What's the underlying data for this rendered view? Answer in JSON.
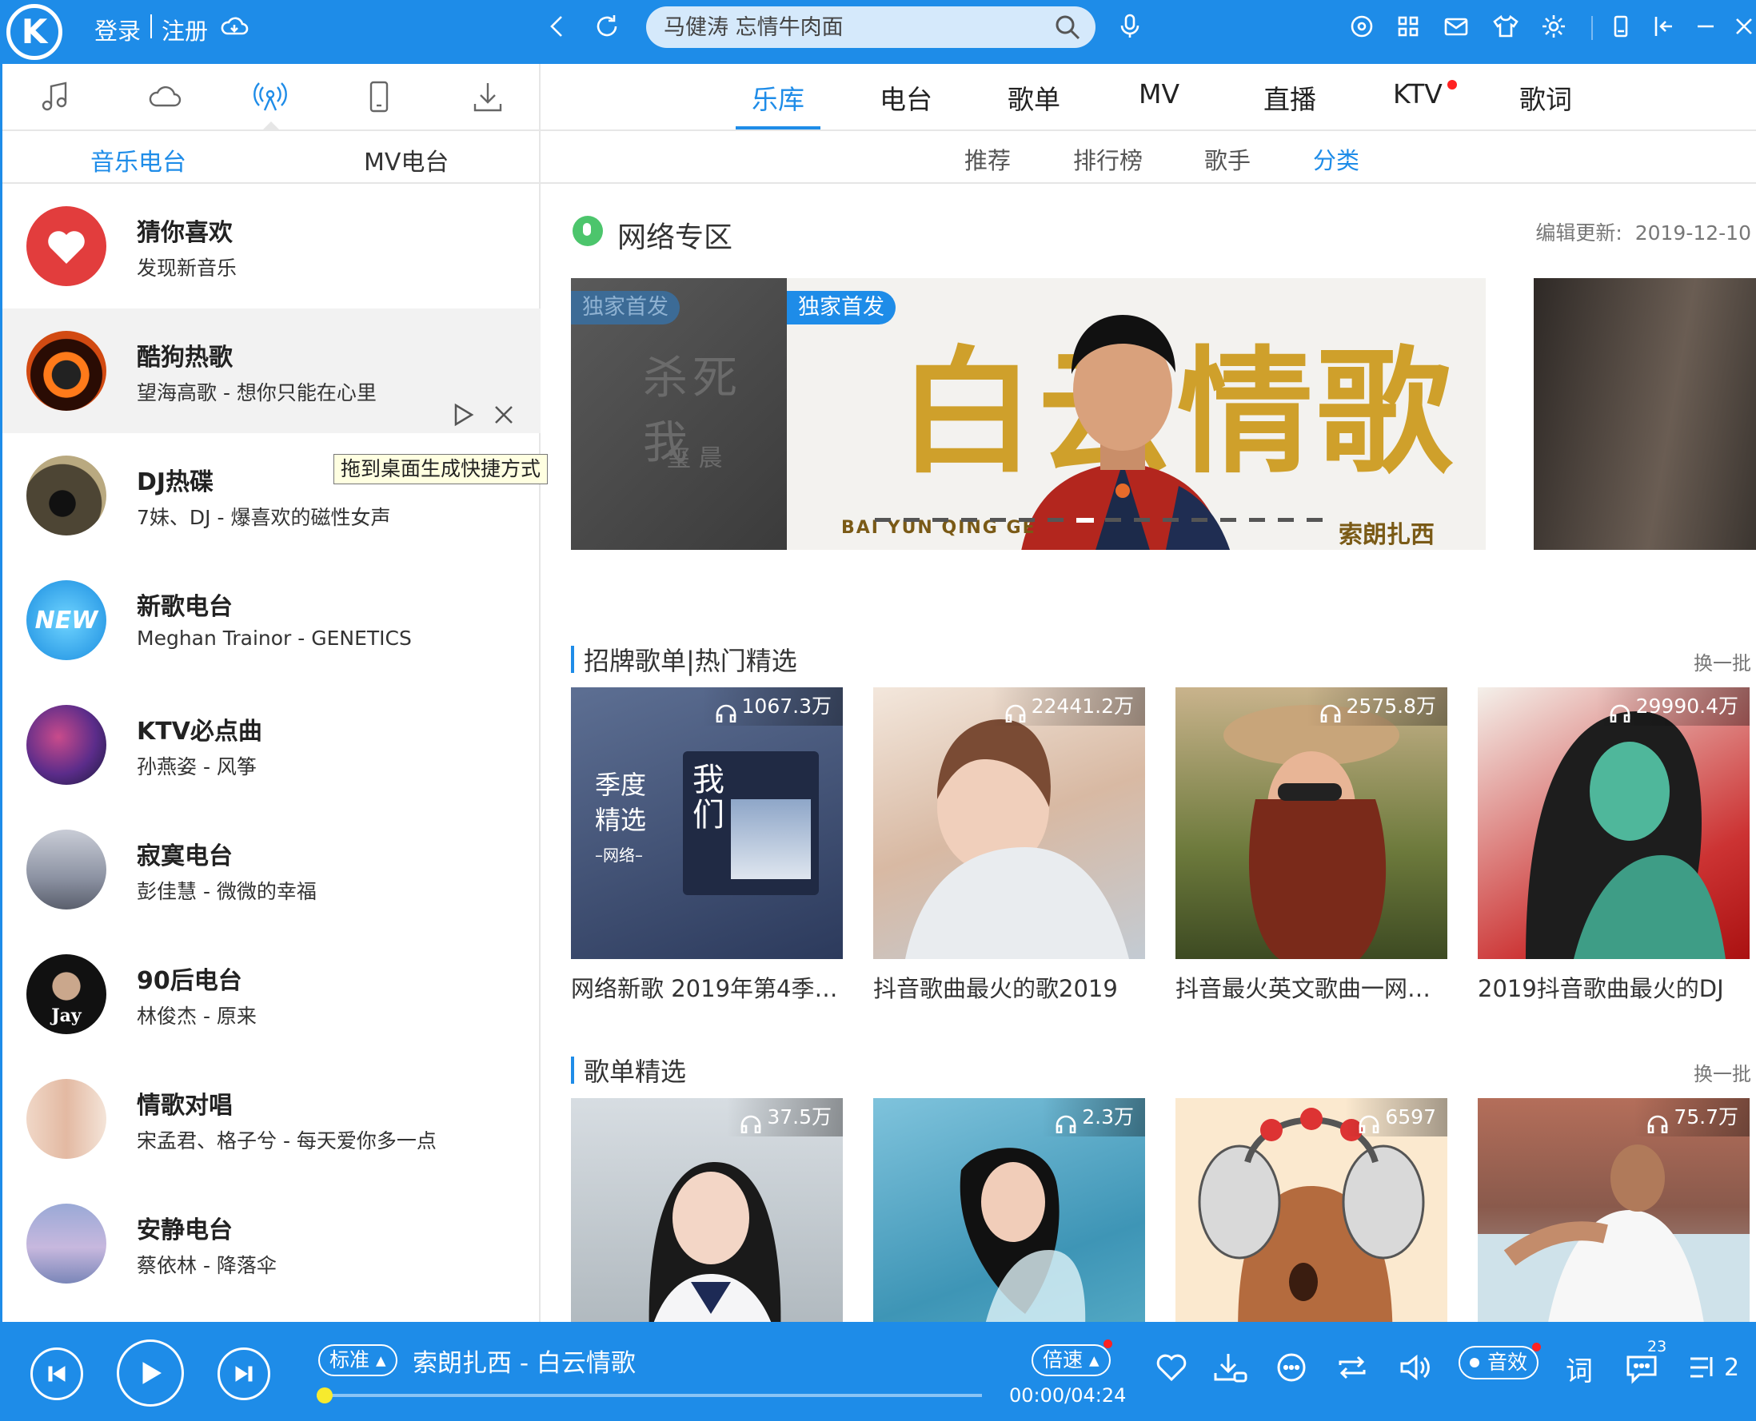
{
  "header": {
    "logo": "K",
    "login": "登录",
    "register": "注册",
    "search_value": "",
    "search_placeholder": "马健涛 忘情牛肉面"
  },
  "left": {
    "subtabs": [
      "音乐电台",
      "MV电台"
    ],
    "items": [
      {
        "title": "猜你喜欢",
        "sub": "发现新音乐"
      },
      {
        "title": "酷狗热歌",
        "sub": "望海高歌 - 想你只能在心里"
      },
      {
        "title": "DJ热碟",
        "sub": "7妹、DJ - 爆喜欢的磁性女声"
      },
      {
        "title": "新歌电台",
        "sub": "Meghan Trainor - GENETICS"
      },
      {
        "title": "KTV必点曲",
        "sub": "孙燕姿 - 风筝"
      },
      {
        "title": "寂寞电台",
        "sub": "彭佳慧 - 微微的幸福"
      },
      {
        "title": "90后电台",
        "sub": "林俊杰 - 原来"
      },
      {
        "title": "情歌对唱",
        "sub": "宋孟君、格子兮 - 每天爱你多一点"
      },
      {
        "title": "安静电台",
        "sub": "蔡依林 - 降落伞"
      }
    ],
    "tooltip": "拖到桌面生成快捷方式",
    "new_badge": "NEW",
    "jay_badge": "Jay"
  },
  "main": {
    "tabs": [
      "乐库",
      "电台",
      "歌单",
      "MV",
      "直播",
      "KTV",
      "歌词"
    ],
    "subnav": [
      "推荐",
      "排行榜",
      "歌手",
      "分类"
    ],
    "section_title": "网络专区",
    "update_label": "编辑更新:",
    "update_date": "2019-12-10",
    "banner": {
      "exclusive": "独家首发",
      "left_title": "杀死我",
      "left_artist": "玺 晨",
      "title": "白云情歌",
      "pinyin": "BAI YUN QING GE",
      "artist": "索朗扎西"
    },
    "block1": {
      "title": "招牌歌单|热门精选",
      "more": "换一批",
      "cards": [
        {
          "count": "1067.3万",
          "name": "网络新歌 2019年第4季【...",
          "cover_text1": "季度",
          "cover_text2": "精选",
          "cover_text3": "–网络–",
          "cover_text4": "我们"
        },
        {
          "count": "22441.2万",
          "name": "抖音歌曲最火的歌2019"
        },
        {
          "count": "2575.8万",
          "name": "抖音最火英文歌曲一网打尽"
        },
        {
          "count": "29990.4万",
          "name": "2019抖音歌曲最火的DJ"
        }
      ]
    },
    "block2": {
      "title": "歌单精选",
      "more": "换一批",
      "cards": [
        {
          "count": "37.5万"
        },
        {
          "count": "2.3万"
        },
        {
          "count": "6597"
        },
        {
          "count": "75.7万"
        }
      ]
    }
  },
  "player": {
    "quality": "标准",
    "now_playing": "索朗扎西 - 白云情歌",
    "speed": "倍速",
    "time": "00:00/04:24",
    "progress": 0,
    "sfx": "音效",
    "lyrics": "词",
    "comments": "23",
    "queue": "2"
  },
  "colors": {
    "accent": "#1e8ce8",
    "banner_gold": "#cfa02b"
  }
}
